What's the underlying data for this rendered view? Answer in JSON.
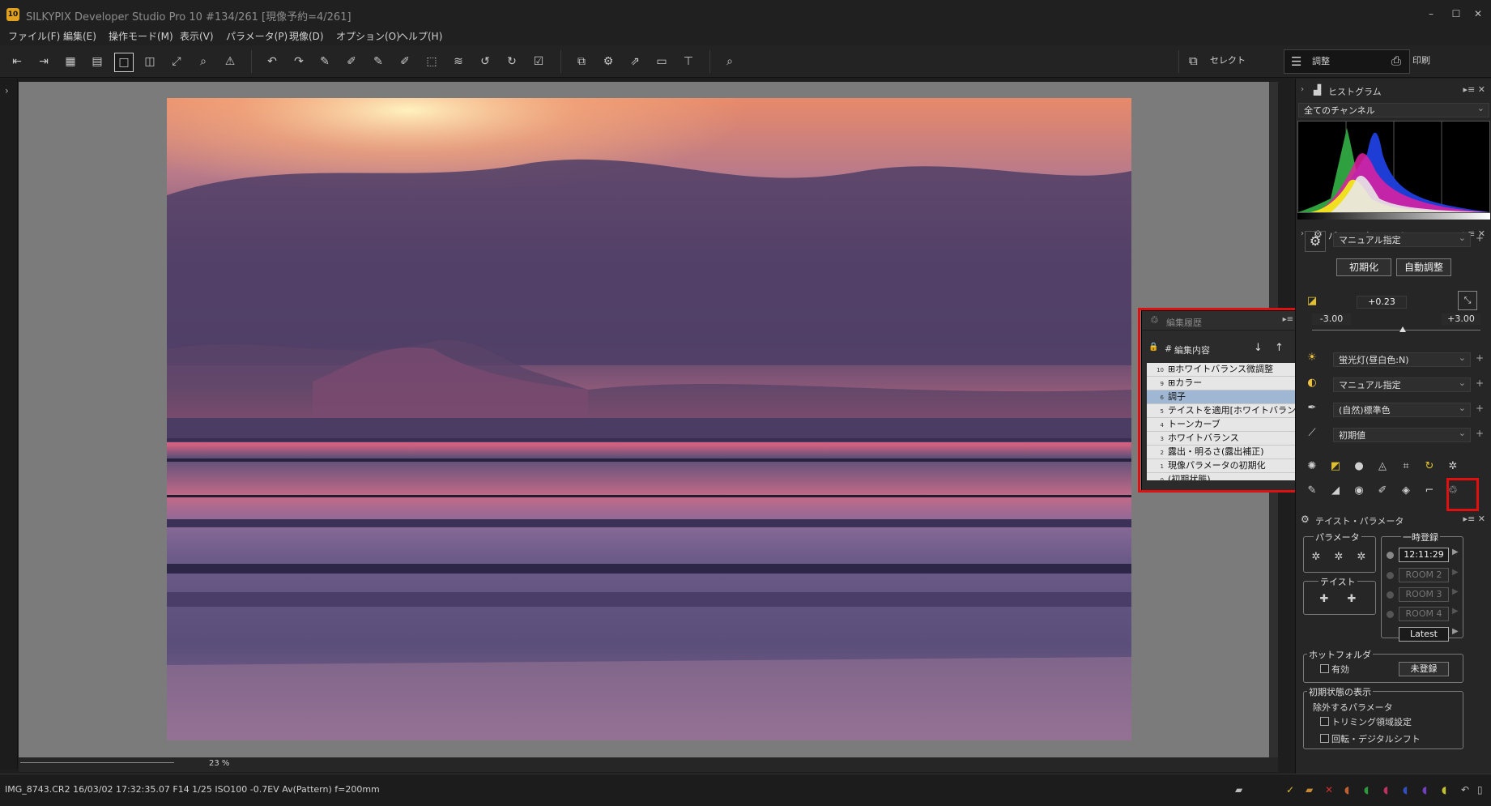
{
  "window": {
    "title": "SILKYPIX Developer Studio Pro 10    #134/261 [現像予約=4/261]",
    "app_badge": "10",
    "controls": [
      "–",
      "☐",
      "✕"
    ]
  },
  "menu": [
    "ファイル(F)",
    "編集(E)",
    "操作モード(M)",
    "表示(V)",
    "パラメータ(P)",
    "現像(D)",
    "オプション(O)",
    "ヘルプ(H)"
  ],
  "toolbar": {
    "modes": [
      {
        "label": "セレクト",
        "icon": "select-icon"
      },
      {
        "label": "調整",
        "icon": "adjust-icon"
      },
      {
        "label": "印刷",
        "icon": "print-icon"
      }
    ]
  },
  "viewer": {
    "zoom_value": "23",
    "zoom_unit": "%"
  },
  "status": {
    "info": "IMG_8743.CR2 16/03/02 17:32:35.07 F14 1/25 ISO100 -0.7EV Av(Pattern) f=200mm"
  },
  "history_panel": {
    "title": "編集履歴",
    "col_num": "#",
    "col_content": "編集内容",
    "rows": [
      {
        "n": "10",
        "label": "⊞ホワイトバランス微調整"
      },
      {
        "n": "9",
        "label": "⊞カラー"
      },
      {
        "n": "6",
        "label": "調子"
      },
      {
        "n": "5",
        "label": "テイストを適用[ホワイトバランス]"
      },
      {
        "n": "4",
        "label": "トーンカーブ"
      },
      {
        "n": "3",
        "label": "ホワイトバランス"
      },
      {
        "n": "2",
        "label": "露出・明るさ(露出補正)"
      },
      {
        "n": "1",
        "label": "現像パラメータの初期化"
      },
      {
        "n": "0",
        "label": "(初期状態)"
      }
    ],
    "selected_index": 2
  },
  "histogram": {
    "title": "ヒストグラム",
    "channel": "全てのチャンネル"
  },
  "param_control": {
    "title": "パラメータ・コントロール",
    "preset": "マニュアル指定",
    "reset_button": "初期化",
    "auto_button": "自動調整",
    "exposure_value": "+0.23",
    "exposure_min": "-3.00",
    "exposure_max": "+3.00",
    "exposure_level": 0.538,
    "white_balance": "蛍光灯(昼白色:N)",
    "tone": "マニュアル指定",
    "color": "(自然)標準色",
    "sharpness": "初期値"
  },
  "taste_params": {
    "title": "テイスト・パラメータ",
    "param_group": "パラメータ",
    "taste_group": "テイスト",
    "temp_group": "一時登録",
    "rooms": [
      {
        "label": "12:11:29",
        "active": true
      },
      {
        "label": "ROOM 2",
        "active": false
      },
      {
        "label": "ROOM 3",
        "active": false
      },
      {
        "label": "ROOM 4",
        "active": false
      }
    ],
    "latest": "Latest",
    "hotfolder_group": "ホットフォルダ",
    "hotfolder_enabled": "有効",
    "hotfolder_button": "未登録",
    "initial_group": "初期状態の表示",
    "exclude_label": "除外するパラメータ",
    "exclude_trim": "トリミング領域設定",
    "exclude_rotate": "回転・デジタルシフト"
  }
}
